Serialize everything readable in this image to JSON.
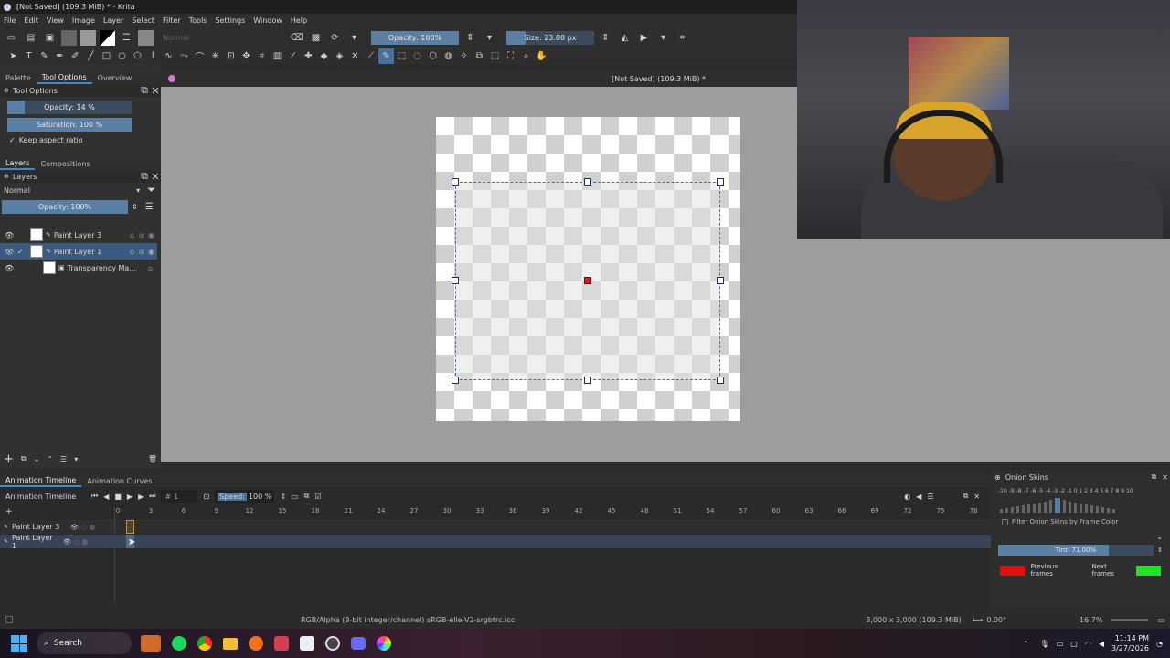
{
  "window": {
    "title": "[Not Saved]  (109.3 MiB) * - Krita"
  },
  "menu": [
    "File",
    "Edit",
    "View",
    "Image",
    "Layer",
    "Select",
    "Filter",
    "Tools",
    "Settings",
    "Window",
    "Help"
  ],
  "toolbar": {
    "blend_mode": "Normal",
    "opacity": "Opacity: 100%",
    "size": "Size: 23.08 px"
  },
  "left_dock": {
    "tabs": [
      "Palette",
      "Tool Options",
      "Overview"
    ],
    "tool_options_title": "Tool Options",
    "opacity": "Opacity: 14 %",
    "opacity_value": 0.14,
    "saturation": "Saturation: 100 %",
    "keep_aspect": "Keep aspect ratio",
    "layer_tabs": [
      "Layers",
      "Compositions"
    ],
    "layers_title": "Layers",
    "layer_blend": "Normal",
    "layer_opacity": "Opacity:  100%",
    "layers": [
      {
        "name": "Paint Layer 3"
      },
      {
        "name": "Paint Layer 1"
      },
      {
        "name": "Transparency Ma..."
      }
    ]
  },
  "canvas": {
    "tab_title": "[Not Saved]  (109.3 MiB) *"
  },
  "timeline": {
    "tabs": [
      "Animation Timeline",
      "Animation Curves"
    ],
    "title": "Animation Timeline",
    "frame": "1",
    "speed_label": "Speed:",
    "speed_value": "100 %",
    "frame_numbers": [
      "0",
      "3",
      "6",
      "9",
      "12",
      "15",
      "18",
      "21",
      "24",
      "27",
      "30",
      "33",
      "36",
      "39",
      "42",
      "45",
      "48",
      "51",
      "54",
      "57",
      "60",
      "63",
      "66",
      "69",
      "72",
      "75",
      "78"
    ],
    "layers": [
      "Paint Layer 3",
      "Paint Layer 1"
    ]
  },
  "onion": {
    "title": "Onion Skins",
    "scale": "-10 -9 -8 -7 -6 -5 -4 -3 -2 -1  0  1  2  3  4  5  6  7  8  9  10",
    "filter_label": "Filter Onion Skins by Frame Color",
    "tint": "Tint: 71.00%",
    "tint_value": 0.71,
    "previous": "Previous frames",
    "next": "Next frames",
    "prev_color": "#e01010",
    "next_color": "#22e022"
  },
  "status": {
    "color_info": "RGB/Alpha (8-bit integer/channel)  sRGB-elle-V2-srgbtrc.icc",
    "dims": "3,000 x 3,000 (109.3 MiB)",
    "angle": "0.00°",
    "zoom": "16.7%"
  },
  "taskbar": {
    "search": "Search",
    "time": "11:14 PM",
    "date": "3/27/2026"
  }
}
